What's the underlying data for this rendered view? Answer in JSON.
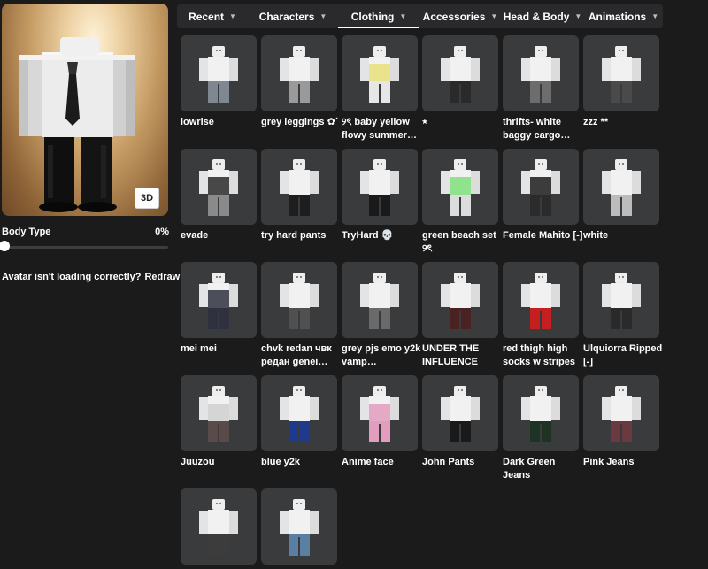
{
  "avatar": {
    "view_button_label": "3D",
    "body_type_label": "Body Type",
    "body_type_value": "0%",
    "body_type_fraction": 0,
    "loading_message": "Avatar isn't loading correctly?",
    "redraw_label": "Redraw"
  },
  "tabs": [
    {
      "label": "Recent",
      "active": false
    },
    {
      "label": "Characters",
      "active": false
    },
    {
      "label": "Clothing",
      "active": true
    },
    {
      "label": "Accessories",
      "active": false
    },
    {
      "label": "Head & Body",
      "active": false
    },
    {
      "label": "Animations",
      "active": false
    }
  ],
  "items": [
    {
      "name": "lowrise",
      "pants_color": "#7f8890",
      "top_accent": ""
    },
    {
      "name": "grey leggings ✿˙",
      "pants_color": "#9a9a9a",
      "top_accent": ""
    },
    {
      "name": "୨ৎ baby yellow flowy summer…",
      "pants_color": "#e6e6e6",
      "top_accent": "#e8e27a"
    },
    {
      "name": "⭒",
      "pants_color": "#2a2a2a",
      "top_accent": ""
    },
    {
      "name": "thrifts- white baggy cargo…",
      "pants_color": "#6d6d6d",
      "top_accent": ""
    },
    {
      "name": "zzz **",
      "pants_color": "#4a4a4a",
      "top_accent": ""
    },
    {
      "name": "evade",
      "pants_color": "#8a8a8a",
      "top_accent": "#2a2a2a"
    },
    {
      "name": "try hard pants",
      "pants_color": "#1e1e1e",
      "top_accent": ""
    },
    {
      "name": "TryHard 💀",
      "pants_color": "#1a1a1a",
      "top_accent": ""
    },
    {
      "name": "green beach set ୨ৎ",
      "pants_color": "#dcdcdc",
      "top_accent": "#7fe07a"
    },
    {
      "name": "Female Mahito [-]",
      "pants_color": "#2b2b2b",
      "top_accent": "#1c1c1c"
    },
    {
      "name": "white",
      "pants_color": "#bcbcbc",
      "top_accent": ""
    },
    {
      "name": "mei mei",
      "pants_color": "#2f3140",
      "top_accent": "#2f3140"
    },
    {
      "name": "chvk redan чвк редан genei…",
      "pants_color": "#505050",
      "top_accent": ""
    },
    {
      "name": "grey pjs emo y2k vamp…",
      "pants_color": "#6a6a6a",
      "top_accent": ""
    },
    {
      "name": "UNDER THE INFLUENCE",
      "pants_color": "#4a2222",
      "top_accent": ""
    },
    {
      "name": "red thigh high socks w stripes",
      "pants_color": "#c61f1f",
      "top_accent": ""
    },
    {
      "name": "Ulquiorra Ripped [-]",
      "pants_color": "#2a2a2a",
      "top_accent": ""
    },
    {
      "name": "Juuzou",
      "pants_color": "#5a4a4a",
      "top_accent": "#d0d0d0"
    },
    {
      "name": "blue y2k",
      "pants_color": "#1f3a8c",
      "top_accent": ""
    },
    {
      "name": "Anime face",
      "pants_color": "#e29cbd",
      "top_accent": "#e29cbd"
    },
    {
      "name": "John Pants",
      "pants_color": "#1a1a1a",
      "top_accent": ""
    },
    {
      "name": "Dark Green Jeans",
      "pants_color": "#1e3324",
      "top_accent": ""
    },
    {
      "name": "Pink Jeans",
      "pants_color": "#6a3a40",
      "top_accent": ""
    },
    {
      "name": "",
      "pants_color": "#3c3c3c",
      "top_accent": ""
    },
    {
      "name": "",
      "pants_color": "#5a7fa3",
      "top_accent": ""
    }
  ]
}
